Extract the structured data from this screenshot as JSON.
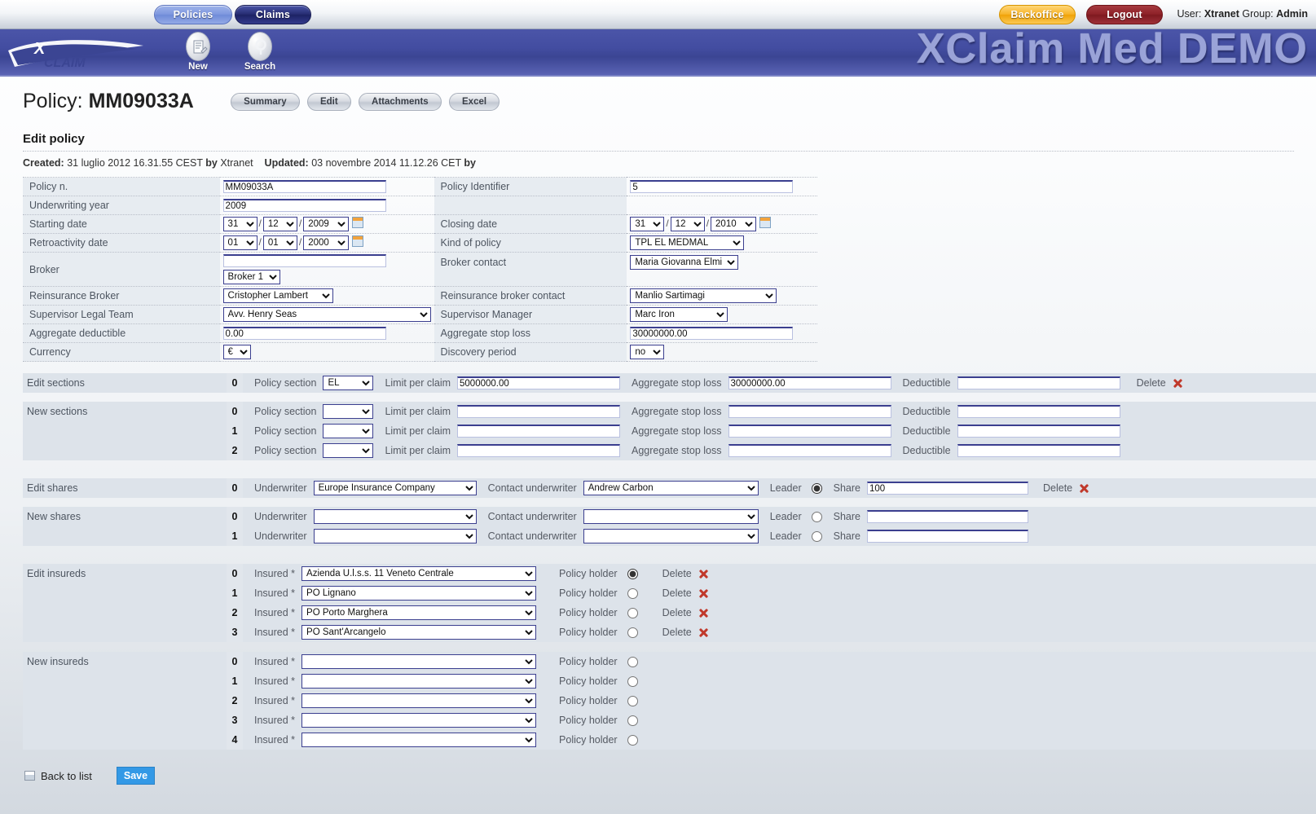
{
  "topnav": {
    "tabs": [
      {
        "label": "Policies",
        "active": false
      },
      {
        "label": "Claims",
        "active": true
      }
    ],
    "backoffice_label": "Backoffice",
    "logout_label": "Logout",
    "user_prefix": "User:",
    "user_name": "Xtranet",
    "group_prefix": "Group:",
    "group_name": "Admin"
  },
  "banner": {
    "logo_text_x": "X",
    "logo_text_claim": "CLAIM",
    "new_label": "New",
    "search_label": "Search",
    "app_title": "XClaim Med DEMO"
  },
  "page": {
    "title_prefix": "Policy:",
    "policy_number": "MM09033A",
    "buttons": [
      "Summary",
      "Edit",
      "Attachments",
      "Excel"
    ],
    "heading": "Edit policy",
    "created_label": "Created:",
    "created_value": "31 luglio 2012 16.31.55 CEST",
    "created_by_label": "by",
    "created_by": "Xtranet",
    "updated_label": "Updated:",
    "updated_value": "03 novembre 2014 11.12.26 CET",
    "updated_by_label": "by"
  },
  "form": {
    "policy_n": {
      "label": "Policy n.",
      "value": "MM09033A"
    },
    "policy_identifier": {
      "label": "Policy Identifier",
      "value": "5"
    },
    "underwriting_year": {
      "label": "Underwriting year",
      "value": "2009"
    },
    "starting_date": {
      "label": "Starting date",
      "day": "31",
      "month": "12",
      "year": "2009"
    },
    "closing_date": {
      "label": "Closing date",
      "day": "31",
      "month": "12",
      "year": "2010"
    },
    "retroactivity_date": {
      "label": "Retroactivity date",
      "day": "01",
      "month": "01",
      "year": "2000"
    },
    "kind_of_policy": {
      "label": "Kind of policy",
      "value": "TPL EL MEDMAL"
    },
    "broker": {
      "label": "Broker",
      "value": "",
      "select_value": "Broker 1"
    },
    "broker_contact": {
      "label": "Broker contact",
      "value": "Maria Giovanna Elmi"
    },
    "reinsurance_broker": {
      "label": "Reinsurance Broker",
      "value": "Cristopher Lambert"
    },
    "reinsurance_broker_contact": {
      "label": "Reinsurance broker contact",
      "value": "Manlio Sartimagi"
    },
    "supervisor_legal_team": {
      "label": "Supervisor Legal Team",
      "value": "Avv. Henry Seas"
    },
    "supervisor_manager": {
      "label": "Supervisor Manager",
      "value": "Marc Iron"
    },
    "aggregate_deductible": {
      "label": "Aggregate deductible",
      "value": "0.00"
    },
    "aggregate_stop_loss": {
      "label": "Aggregate stop loss",
      "value": "30000000.00"
    },
    "currency": {
      "label": "Currency",
      "value": "€"
    },
    "discovery_period": {
      "label": "Discovery period",
      "value": "no"
    }
  },
  "sections": {
    "edit_title": "Edit sections",
    "new_title": "New sections",
    "cap_policy_section": "Policy section",
    "cap_limit": "Limit per claim",
    "cap_stoploss": "Aggregate stop loss",
    "cap_deductible": "Deductible",
    "delete_label": "Delete",
    "edit_rows": [
      {
        "idx": "0",
        "policy_section": "EL",
        "limit_per_claim": "5000000.00",
        "aggregate_stop_loss": "30000000.00",
        "deductible": ""
      }
    ],
    "new_rows": [
      {
        "idx": "0",
        "policy_section": "",
        "limit_per_claim": "",
        "aggregate_stop_loss": "",
        "deductible": ""
      },
      {
        "idx": "1",
        "policy_section": "",
        "limit_per_claim": "",
        "aggregate_stop_loss": "",
        "deductible": ""
      },
      {
        "idx": "2",
        "policy_section": "",
        "limit_per_claim": "",
        "aggregate_stop_loss": "",
        "deductible": ""
      }
    ]
  },
  "shares": {
    "edit_title": "Edit shares",
    "new_title": "New shares",
    "cap_underwriter": "Underwriter",
    "cap_contact": "Contact underwriter",
    "cap_leader": "Leader",
    "cap_share": "Share",
    "delete_label": "Delete",
    "edit_rows": [
      {
        "idx": "0",
        "underwriter": "Europe Insurance Company",
        "contact": "Andrew Carbon",
        "leader": true,
        "share": "100"
      }
    ],
    "new_rows": [
      {
        "idx": "0",
        "underwriter": "",
        "contact": "",
        "leader": false,
        "share": ""
      },
      {
        "idx": "1",
        "underwriter": "",
        "contact": "",
        "leader": false,
        "share": ""
      }
    ]
  },
  "insureds": {
    "edit_title": "Edit insureds",
    "new_title": "New insureds",
    "cap_insured": "Insured *",
    "cap_policy_holder": "Policy holder",
    "delete_label": "Delete",
    "edit_rows": [
      {
        "idx": "0",
        "insured": "Azienda U.l.s.s. 11 Veneto Centrale",
        "policy_holder": true
      },
      {
        "idx": "1",
        "insured": "PO Lignano",
        "policy_holder": false
      },
      {
        "idx": "2",
        "insured": "PO Porto Marghera",
        "policy_holder": false
      },
      {
        "idx": "3",
        "insured": "PO Sant'Arcangelo",
        "policy_holder": false
      }
    ],
    "new_rows": [
      {
        "idx": "0",
        "insured": "",
        "policy_holder": false
      },
      {
        "idx": "1",
        "insured": "",
        "policy_holder": false
      },
      {
        "idx": "2",
        "insured": "",
        "policy_holder": false
      },
      {
        "idx": "3",
        "insured": "",
        "policy_holder": false
      },
      {
        "idx": "4",
        "insured": "",
        "policy_holder": false
      }
    ]
  },
  "footer": {
    "back_label": "Back to list",
    "save_label": "Save"
  },
  "colors": {
    "banner_blue": "#434da1",
    "tab_active": "#262c72",
    "tab_inactive": "#7e97df",
    "backoffice": "#f7b327",
    "logout": "#8e2128",
    "save_blue": "#3399e6",
    "delete_red": "#c0392b",
    "label_bg": "#e7ecf1",
    "row_shade": "#dde3ea"
  }
}
